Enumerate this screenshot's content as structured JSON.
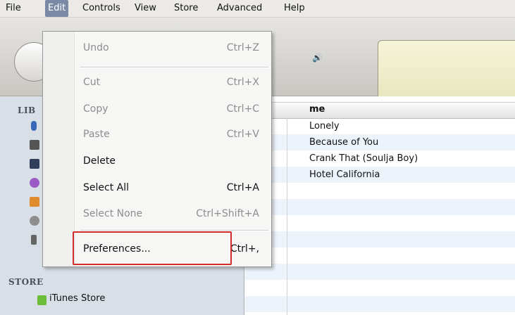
{
  "menubar": {
    "items": [
      {
        "label": "File"
      },
      {
        "label": "Edit"
      },
      {
        "label": "Controls"
      },
      {
        "label": "View"
      },
      {
        "label": "Store"
      },
      {
        "label": "Advanced"
      },
      {
        "label": "Help"
      }
    ],
    "active_index": 1
  },
  "toolbar": {
    "volume_icon": "speaker-icon"
  },
  "sidebar": {
    "library_heading": "LIB",
    "store_heading": "STORE",
    "store_item": "iTunes Store",
    "icons": [
      "music-note-icon",
      "movie-icon",
      "tv-icon",
      "podcast-icon",
      "audiobook-icon",
      "radio-icon",
      "app-icon"
    ]
  },
  "list": {
    "column_header": "me",
    "rows": [
      "Lonely",
      "Because of You",
      "Crank That (Soulja Boy)",
      "Hotel California"
    ]
  },
  "edit_menu": {
    "items": [
      {
        "label": "Undo",
        "shortcut": "Ctrl+Z",
        "enabled": false
      },
      {
        "label": "Cut",
        "shortcut": "Ctrl+X",
        "enabled": false
      },
      {
        "label": "Copy",
        "shortcut": "Ctrl+C",
        "enabled": false
      },
      {
        "label": "Paste",
        "shortcut": "Ctrl+V",
        "enabled": false
      },
      {
        "label": "Delete",
        "shortcut": "",
        "enabled": true
      },
      {
        "label": "Select All",
        "shortcut": "Ctrl+A",
        "enabled": true
      },
      {
        "label": "Select None",
        "shortcut": "Ctrl+Shift+A",
        "enabled": false
      },
      {
        "label": "Preferences...",
        "shortcut": "Ctrl+,",
        "enabled": true
      }
    ]
  },
  "colors": {
    "highlight_border": "#d32a2a",
    "menu_active_bg": "#7a8aa6",
    "sidebar_bg": "#d9dfe7",
    "lcd_bg": "#f0efcc"
  }
}
